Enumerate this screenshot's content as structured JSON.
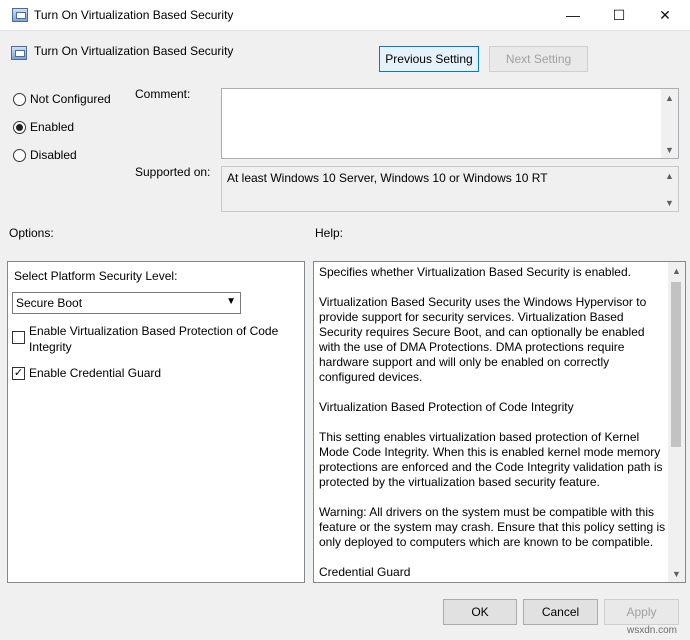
{
  "window": {
    "title": "Turn On Virtualization Based Security",
    "controls": {
      "minimize": "—",
      "maximize": "☐",
      "close": "✕"
    }
  },
  "header": {
    "setting_title": "Turn On Virtualization Based Security",
    "previous_label": "Previous Setting",
    "next_label": "Next Setting"
  },
  "state": {
    "options": [
      {
        "label": "Not Configured",
        "selected": false
      },
      {
        "label": "Enabled",
        "selected": true
      },
      {
        "label": "Disabled",
        "selected": false
      }
    ]
  },
  "comment": {
    "label": "Comment:",
    "value": ""
  },
  "supported": {
    "label": "Supported on:",
    "value": "At least Windows 10 Server, Windows 10 or Windows 10 RT"
  },
  "sections": {
    "options_label": "Options:",
    "help_label": "Help:"
  },
  "options_panel": {
    "platform_label": "Select Platform Security Level:",
    "platform_value": "Secure Boot",
    "code_integrity_label_1": "Enable Virtualization Based Protection of Code",
    "code_integrity_label_2": "Integrity",
    "code_integrity_checked": false,
    "credential_guard_label": "Enable Credential Guard",
    "credential_guard_checked": true
  },
  "help": {
    "paragraphs": [
      "Specifies whether Virtualization Based Security is enabled.",
      "Virtualization Based Security uses the Windows Hypervisor to provide support for security services.  Virtualization Based Security requires Secure Boot, and can optionally be enabled with the use of DMA Protections.  DMA protections require hardware support and will only be enabled on correctly configured devices.",
      "Virtualization Based Protection of Code Integrity",
      "This setting enables virtualization based protection of Kernel Mode Code Integrity. When this is enabled kernel mode memory protections are enforced and the Code Integrity validation path is protected by the virtualization based security feature.",
      "Warning: All drivers on the system must be compatible with this feature or the system may crash. Ensure that this policy setting is only deployed to computers which are known to be compatible.",
      "Credential Guard"
    ]
  },
  "footer": {
    "ok_label": "OK",
    "cancel_label": "Cancel",
    "apply_label": "Apply"
  },
  "watermark": "wsxdn.com"
}
